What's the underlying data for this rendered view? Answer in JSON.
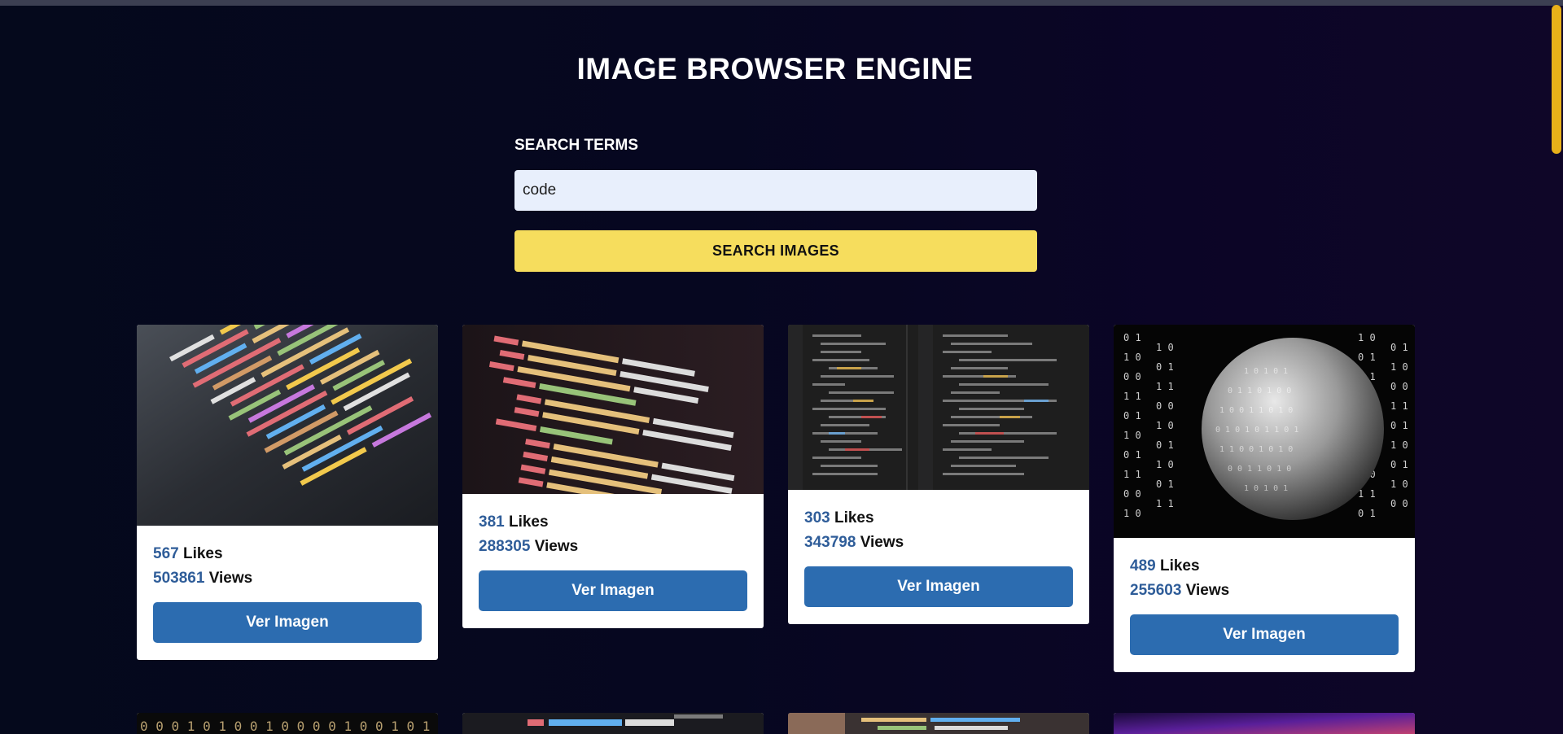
{
  "page": {
    "title": "IMAGE BROWSER ENGINE"
  },
  "search": {
    "label": "SEARCH TERMS",
    "value": "code",
    "button_label": "SEARCH IMAGES"
  },
  "results": [
    {
      "likes": "567",
      "likes_label": "Likes",
      "views": "503861",
      "views_label": "Views",
      "button_label": "Ver Imagen"
    },
    {
      "likes": "381",
      "likes_label": "Likes",
      "views": "288305",
      "views_label": "Views",
      "button_label": "Ver Imagen"
    },
    {
      "likes": "303",
      "likes_label": "Likes",
      "views": "343798",
      "views_label": "Views",
      "button_label": "Ver Imagen"
    },
    {
      "likes": "489",
      "likes_label": "Likes",
      "views": "255603",
      "views_label": "Views",
      "button_label": "Ver Imagen"
    }
  ],
  "colors": {
    "background": "#05091c",
    "search_button": "#f6dd5d",
    "search_input": "#e8effc",
    "card_button": "#2c6cb0",
    "stat_number": "#2f5d99",
    "scrollbar": "#e8b019"
  }
}
